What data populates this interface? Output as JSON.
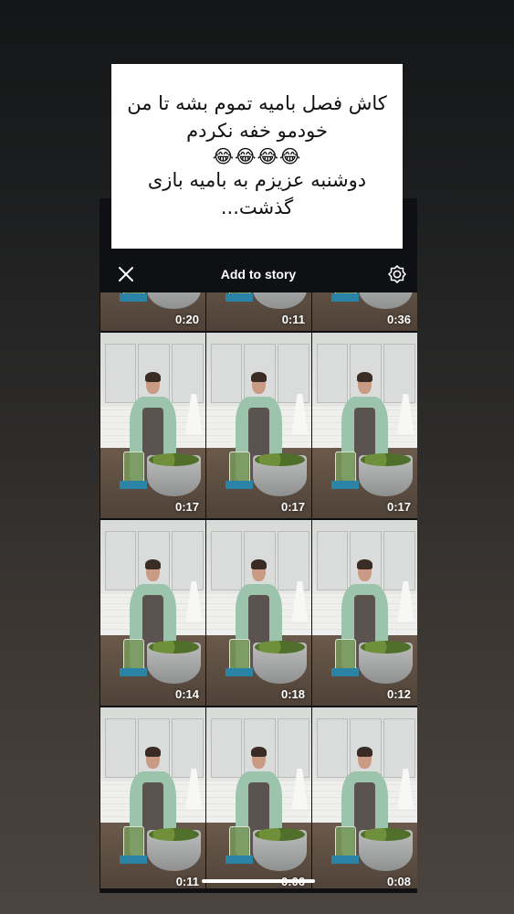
{
  "caption": {
    "line1": "کاش فصل بامیه تموم بشه تا من",
    "line2": "خودمو خفه نکردم",
    "emoji": "😂😂😂😂",
    "line3": "دوشنبه عزیزم به بامیه بازی",
    "line4": "گذشت..."
  },
  "header": {
    "title": "Add to story",
    "close_icon": "close-icon",
    "settings_icon": "settings-icon"
  },
  "grid": {
    "rows": [
      [
        "0:20",
        "0:11",
        "0:36"
      ],
      [
        "0:17",
        "0:17",
        "0:17"
      ],
      [
        "0:14",
        "0:18",
        "0:12"
      ],
      [
        "0:11",
        "0:06",
        "0:08"
      ]
    ]
  },
  "colors": {
    "panel": "#0e1013",
    "accent_mat": "#2b84a6",
    "shirt": "#9cc4ad"
  }
}
